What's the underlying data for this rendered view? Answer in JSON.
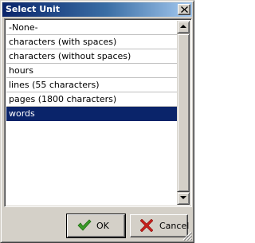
{
  "window": {
    "title": "Select Unit"
  },
  "list": {
    "items": [
      {
        "label": "-None-",
        "selected": false
      },
      {
        "label": "characters (with spaces)",
        "selected": false
      },
      {
        "label": "characters (without spaces)",
        "selected": false
      },
      {
        "label": "hours",
        "selected": false
      },
      {
        "label": "lines (55 characters)",
        "selected": false
      },
      {
        "label": "pages (1800 characters)",
        "selected": false
      },
      {
        "label": "words",
        "selected": true
      }
    ]
  },
  "buttons": {
    "ok_label": "OK",
    "cancel_label": "Cancel"
  },
  "icons": {
    "ok": "green-checkmark-icon",
    "cancel": "red-x-icon",
    "close": "close-icon"
  },
  "colors": {
    "title_bar": "#0a246a",
    "selection": "#0a246a",
    "face": "#d4d0c8",
    "check_green": "#3a9a28",
    "cancel_red": "#c8201c"
  }
}
